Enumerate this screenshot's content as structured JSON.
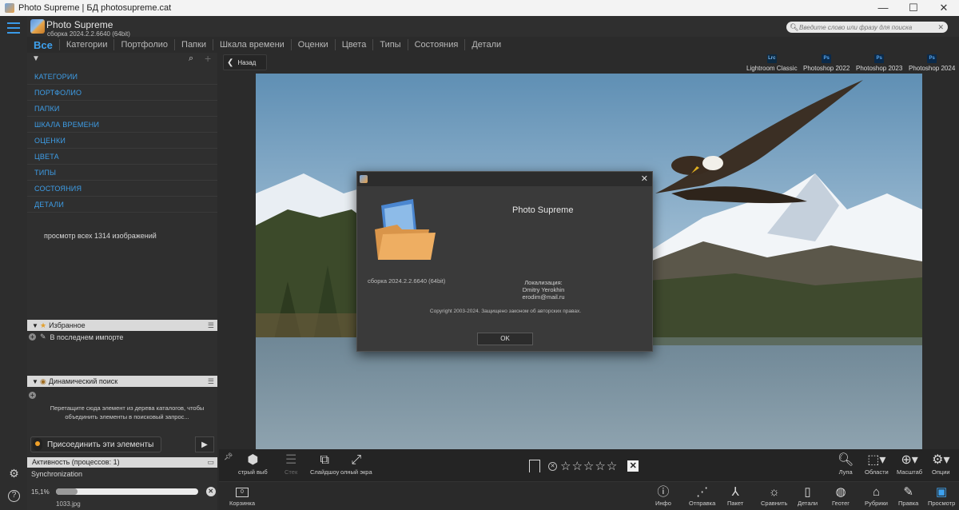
{
  "window": {
    "title": "Photo Supreme | БД photosupreme.cat",
    "min": "—",
    "max": "☐",
    "close": "✕"
  },
  "header": {
    "app_name": "Photo Supreme",
    "build": "сборка 2024.2.2.6640 (64bit)",
    "search_placeholder": "Введите слово или фразу для поиска"
  },
  "nav_tabs": [
    "Все",
    "Категории",
    "Портфолио",
    "Папки",
    "Шкала времени",
    "Оценки",
    "Цвета",
    "Типы",
    "Состояния",
    "Детали"
  ],
  "tree": {
    "items": [
      "КАТЕГОРИИ",
      "ПОРТФОЛИО",
      "ПАПКИ",
      "ШКАЛА ВРЕМЕНИ",
      "ОЦЕНКИ",
      "ЦВЕТА",
      "ТИПЫ",
      "СОСТОЯНИЯ",
      "ДЕТАЛИ"
    ],
    "browse_text": "просмотр всех 1314 изображений"
  },
  "favorites": {
    "title": "Избранное",
    "item": "В последнем импорте"
  },
  "dynamic": {
    "title": "Динамический поиск",
    "hint": "Перетащите сюда элемент из дерева каталогов, чтобы объединить элементы в поисковый запрос...",
    "attach_label": "Присоединить эти элементы"
  },
  "activity": {
    "title": "Активность (процессов: 1)",
    "task": "Synchronization",
    "percent_text": "15,1%",
    "progress": 0.151,
    "file": "1033.jpg"
  },
  "content": {
    "back_label": "Назад",
    "external_editors": [
      {
        "badge": "Lrc",
        "label": "Lightroom Classic"
      },
      {
        "badge": "Ps",
        "label": "Photoshop 2022"
      },
      {
        "badge": "Ps",
        "label": "Photoshop 2023"
      },
      {
        "badge": "Ps",
        "label": "Photoshop 2024"
      }
    ]
  },
  "dialog": {
    "app_name": "Photo Supreme",
    "build": "сборка 2024.2.2.6640 (64bit)",
    "localization_label": "Локализация:",
    "localization_name": "Dmitry Yerokhin",
    "localization_email": "erodim@mail.ru",
    "copyright": "Copyright 2003-2024. Защищено законом об авторских правах.",
    "ok": "OK"
  },
  "toolbar1": {
    "quick_select": "стрый выб",
    "stack": "Стек",
    "slideshow": "Слайдшоу",
    "fullscreen": "олный экра",
    "loupe": "Лупа",
    "areas": "Области",
    "zoom": "Масштаб",
    "options": "Опции",
    "rating_stars": 0
  },
  "toolbar2": {
    "basket": "Корзинка",
    "basket_count": "0",
    "info": "Инфо",
    "send": "Отправка",
    "batch": "Пакет",
    "compare": "Сравнить",
    "details": "Детали",
    "geotag": "Геотег",
    "tags": "Рубрики",
    "edit": "Правка",
    "view": "Просмотр"
  },
  "colors": {
    "accent": "#3ea1ee",
    "panel_bg": "#2f2f2f",
    "section_header": "#d9d9d9"
  }
}
